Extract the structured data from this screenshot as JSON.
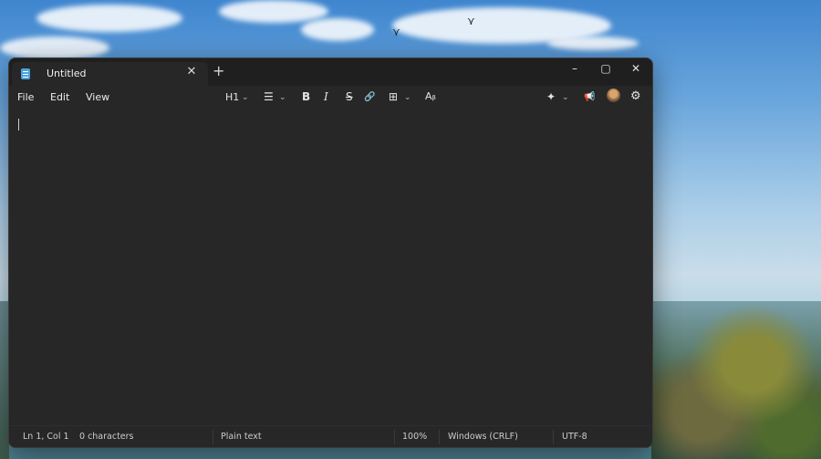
{
  "tab": {
    "title": "Untitled",
    "close_glyph": "✕",
    "new_tab_glyph": "+"
  },
  "window_controls": {
    "minimize": "–",
    "maximize": "▢",
    "close": "✕"
  },
  "menu": {
    "file": "File",
    "edit": "Edit",
    "view": "View"
  },
  "toolbar": {
    "heading": "H1",
    "chevron": "⌄",
    "list_icon": "☰",
    "bold": "B",
    "italic": "I",
    "strikethrough": "S",
    "link_icon": "🔗",
    "table_icon": "⊞",
    "spellcheck_icon": "Aᵦ",
    "copilot_icon": "✦",
    "feedback_icon": "📢",
    "settings_icon": "⚙"
  },
  "status": {
    "position": "Ln 1, Col 1",
    "characters": "0 characters",
    "format": "Plain text",
    "zoom": "100%",
    "line_ending": "Windows (CRLF)",
    "encoding": "UTF-8"
  },
  "colors": {
    "window_bg": "#272727",
    "titlebar_bg": "#1f1f1f",
    "accent": "#4aa3df"
  }
}
